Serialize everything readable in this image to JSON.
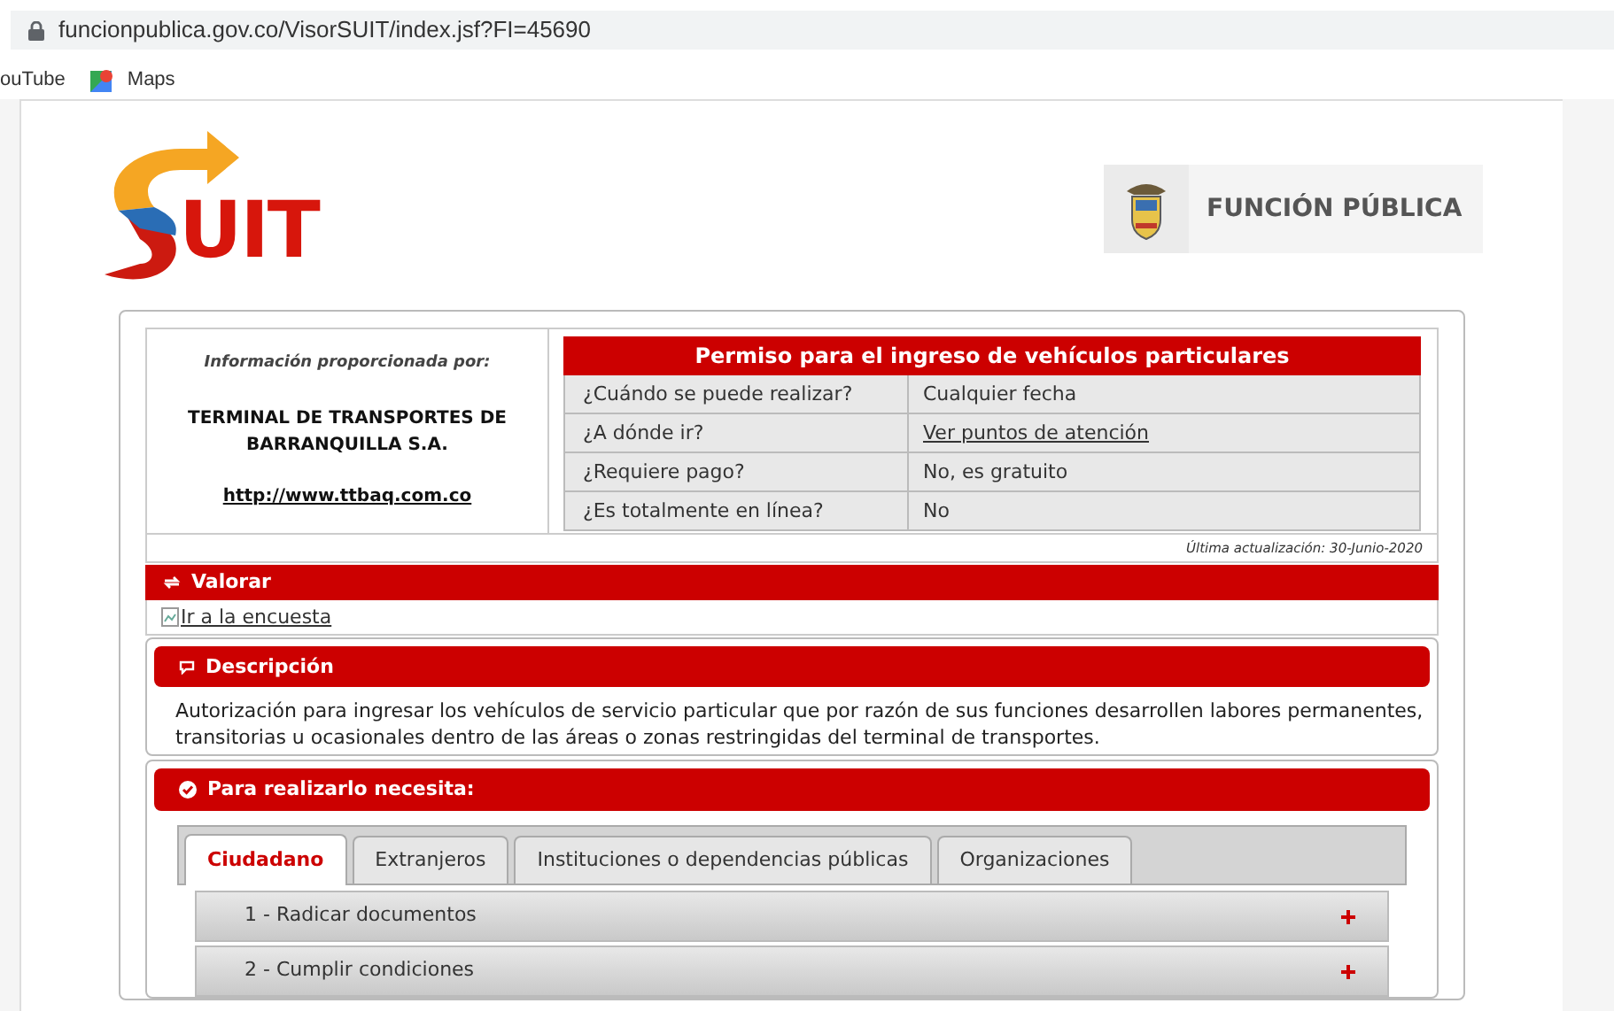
{
  "browser": {
    "url": "funcionpublica.gov.co/VisorSUIT/index.jsf?FI=45690",
    "bookmarks": [
      {
        "label": "ouTube",
        "kind": "plain"
      },
      {
        "label": "Maps",
        "kind": "maps"
      }
    ]
  },
  "header": {
    "logo_text": "UIT",
    "brand": "FUNCIÓN PÚBLICA"
  },
  "procedure": {
    "provider_label": "Información proporcionada por:",
    "provider_name": "TERMINAL DE TRANSPORTES DE BARRANQUILLA S.A.",
    "provider_url": "http://www.ttbaq.com.co",
    "title": "Permiso para el ingreso de vehículos particulares",
    "rows": [
      {
        "question": "¿Cuándo se puede realizar?",
        "answer": "Cualquier fecha",
        "kind": "text"
      },
      {
        "question": "¿A dónde ir?",
        "answer": "Ver puntos de atención",
        "kind": "link"
      },
      {
        "question": "¿Requiere pago?",
        "answer": "No, es gratuito",
        "kind": "text"
      },
      {
        "question": "¿Es totalmente en línea?",
        "answer": "No",
        "kind": "text"
      }
    ],
    "last_update": "Última actualización: 30-Junio-2020"
  },
  "rating": {
    "title": "Valorar",
    "link": "Ir a la encuesta"
  },
  "description": {
    "title": "Descripción",
    "text": "Autorización para ingresar los vehículos de servicio particular que por razón de sus funciones desarrollen labores permanentes, transitorias u ocasionales dentro de las áreas o zonas restringidas del terminal de transportes."
  },
  "requirements": {
    "title": "Para realizarlo necesita:",
    "tabs": [
      {
        "label": "Ciudadano",
        "selected": true
      },
      {
        "label": "Extranjeros",
        "selected": false
      },
      {
        "label": "Instituciones o dependencias públicas",
        "selected": false
      },
      {
        "label": "Organizaciones",
        "selected": false
      }
    ],
    "steps": [
      {
        "label": "1 - Radicar documentos",
        "expanded": false
      },
      {
        "label": "2 - Cumplir condiciones",
        "expanded": false
      }
    ]
  }
}
